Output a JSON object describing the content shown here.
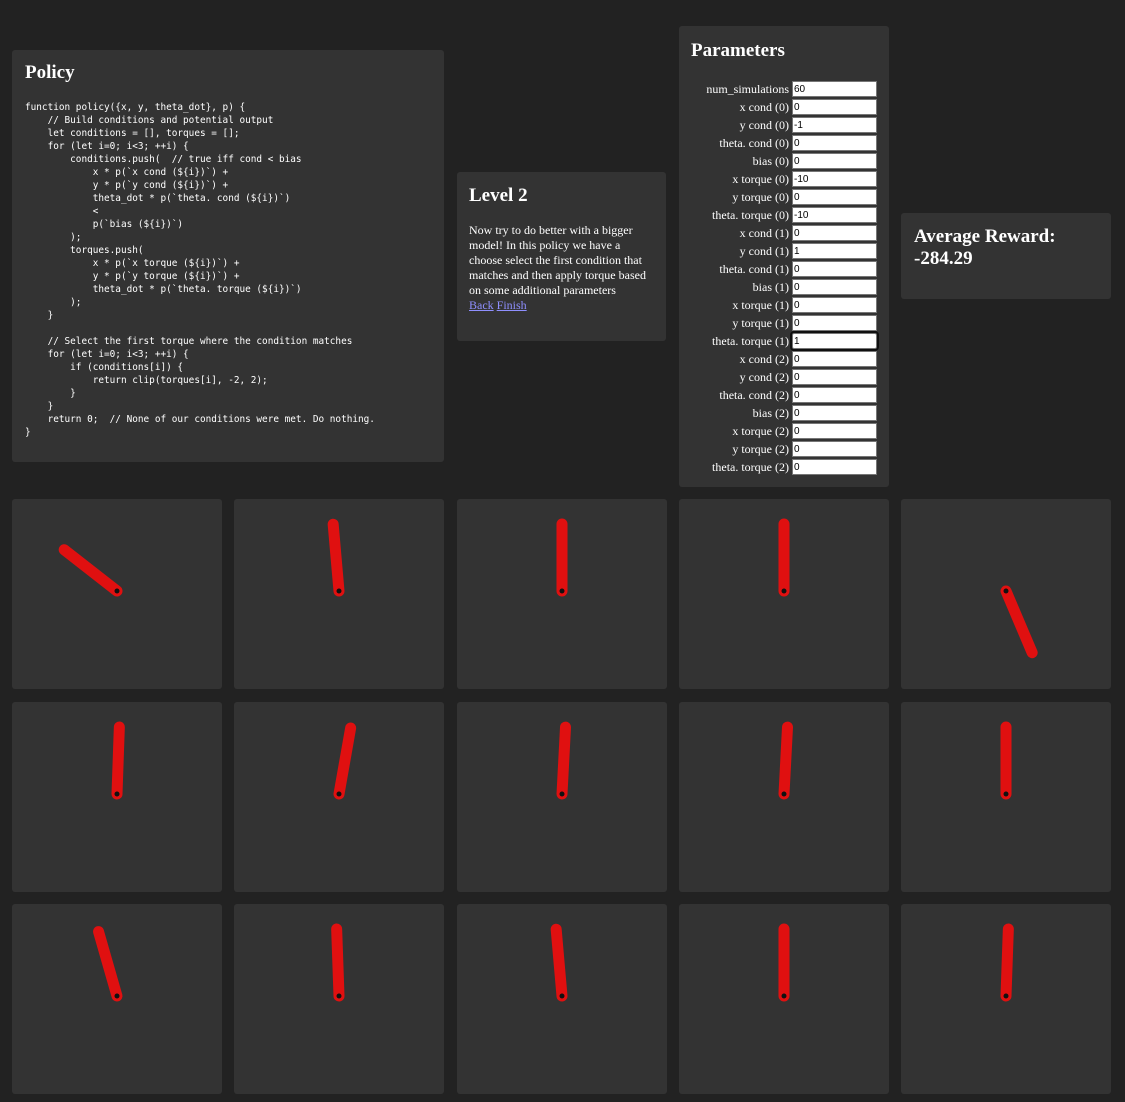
{
  "policy": {
    "title": "Policy",
    "code": "function policy({x, y, theta_dot}, p) {\n    // Build conditions and potential output\n    let conditions = [], torques = [];\n    for (let i=0; i<3; ++i) {\n        conditions.push(  // true iff cond < bias\n            x * p(`x cond (${i})`) +\n            y * p(`y cond (${i})`) +\n            theta_dot * p(`theta. cond (${i})`)\n            <\n            p(`bias (${i})`)\n        );\n        torques.push(\n            x * p(`x torque (${i})`) +\n            y * p(`y torque (${i})`) +\n            theta_dot * p(`theta. torque (${i})`)\n        );\n    }\n\n    // Select the first torque where the condition matches\n    for (let i=0; i<3; ++i) {\n        if (conditions[i]) {\n            return clip(torques[i], -2, 2);\n        }\n    }\n    return 0;  // None of our conditions were met. Do nothing.\n}"
  },
  "level": {
    "title": "Level 2",
    "description": "Now try to do better with a bigger model! In this policy we have a choose select the first condition that matches and then apply torque based on some additional parameters",
    "back_label": "Back",
    "finish_label": "Finish"
  },
  "parameters": {
    "title": "Parameters",
    "fields": [
      {
        "label": "num_simulations",
        "value": "60"
      },
      {
        "label": "x cond (0)",
        "value": "0"
      },
      {
        "label": "y cond (0)",
        "value": "-1"
      },
      {
        "label": "theta. cond (0)",
        "value": "0"
      },
      {
        "label": "bias (0)",
        "value": "0"
      },
      {
        "label": "x torque (0)",
        "value": "-10"
      },
      {
        "label": "y torque (0)",
        "value": "0"
      },
      {
        "label": "theta. torque (0)",
        "value": "-10"
      },
      {
        "label": "x cond (1)",
        "value": "0"
      },
      {
        "label": "y cond (1)",
        "value": "1"
      },
      {
        "label": "theta. cond (1)",
        "value": "0"
      },
      {
        "label": "bias (1)",
        "value": "0"
      },
      {
        "label": "x torque (1)",
        "value": "0"
      },
      {
        "label": "y torque (1)",
        "value": "0"
      },
      {
        "label": "theta. torque (1)",
        "value": "1",
        "focused": true
      },
      {
        "label": "x cond (2)",
        "value": "0"
      },
      {
        "label": "y cond (2)",
        "value": "0"
      },
      {
        "label": "theta. cond (2)",
        "value": "0"
      },
      {
        "label": "bias (2)",
        "value": "0"
      },
      {
        "label": "x torque (2)",
        "value": "0"
      },
      {
        "label": "y torque (2)",
        "value": "0"
      },
      {
        "label": "theta. torque (2)",
        "value": "0"
      }
    ]
  },
  "reward": {
    "label": "Average Reward:",
    "value": "-284.29"
  },
  "simulations": {
    "pole_color": "#e01010",
    "pivot_color": "#111111",
    "angles_deg": [
      -52,
      -5,
      0,
      0,
      157,
      2,
      10,
      3,
      3,
      0,
      -16,
      -2,
      -5,
      0,
      2
    ]
  }
}
